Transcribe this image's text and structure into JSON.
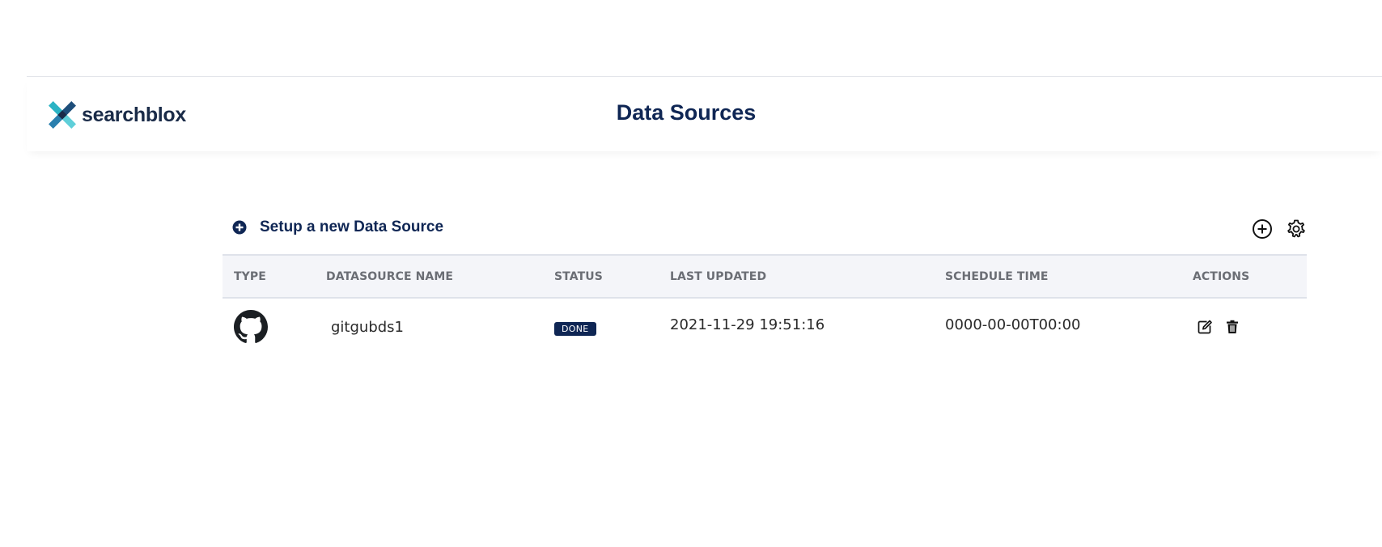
{
  "header": {
    "logo_text": "searchblox",
    "title": "Data Sources"
  },
  "toolbar": {
    "setup_label": "Setup a new Data Source",
    "icons": [
      "add-icon",
      "settings-icon"
    ]
  },
  "table": {
    "columns": [
      "TYPE",
      "DATASOURCE NAME",
      "STATUS",
      "LAST UPDATED",
      "SCHEDULE TIME",
      "ACTIONS"
    ],
    "rows": [
      {
        "type_icon": "github-icon",
        "name": "gitgubds1",
        "status": "DONE",
        "last_updated": "2021-11-29 19:51:16",
        "schedule_time": "0000-00-00T00:00",
        "actions": [
          "edit-icon",
          "delete-icon"
        ]
      }
    ]
  },
  "colors": {
    "brand_navy": "#0f2654",
    "logo_teal": "#2ab3c4",
    "header_bg": "#f4f5f9"
  }
}
